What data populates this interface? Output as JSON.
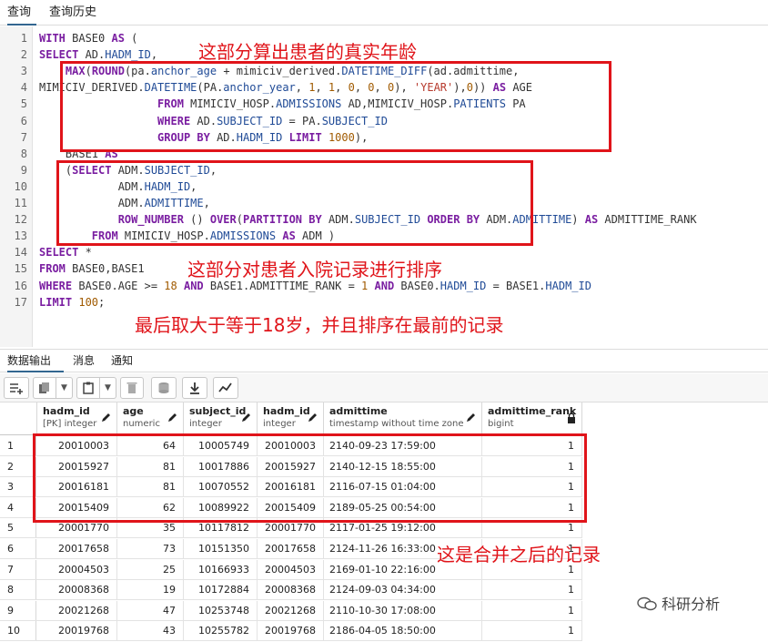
{
  "tabs": [
    "查询",
    "查询历史"
  ],
  "code_lines": [
    "WITH BASE0 AS (",
    "SELECT AD.HADM_ID,",
    "    MAX(ROUND(pa.anchor_age + mimiciv_derived.DATETIME_DIFF(ad.admittime,",
    "MIMICIV_DERIVED.DATETIME(PA.anchor_year, 1, 1, 0, 0, 0), 'YEAR'),0)) AS AGE",
    "                  FROM MIMICIV_HOSP.ADMISSIONS AD,MIMICIV_HOSP.PATIENTS PA",
    "                  WHERE AD.SUBJECT_ID = PA.SUBJECT_ID",
    "                  GROUP BY AD.HADM_ID LIMIT 1000),",
    "    BASE1 AS",
    "    (SELECT ADM.SUBJECT_ID,",
    "            ADM.HADM_ID,",
    "            ADM.ADMITTIME,",
    "            ROW_NUMBER () OVER(PARTITION BY ADM.SUBJECT_ID ORDER BY ADM.ADMITTIME) AS ADMITTIME_RANK",
    "        FROM MIMICIV_HOSP.ADMISSIONS AS ADM )",
    "SELECT *",
    "FROM BASE0,BASE1",
    "WHERE BASE0.AGE >= 18 AND BASE1.ADMITTIME_RANK = 1 AND BASE0.HADM_ID = BASE1.HADM_ID",
    "LIMIT 100;"
  ],
  "annotations": {
    "age": "这部分算出患者的真实年龄",
    "rank": "这部分对患者入院记录进行排序",
    "filter": "最后取大于等于18岁，并且排序在最前的记录",
    "merged": "这是合并之后的记录"
  },
  "output_tabs": [
    "数据输出",
    "消息",
    "通知"
  ],
  "toolbar_icons": [
    "add-row-icon",
    "copy-icon",
    "paste-icon",
    "delete-icon",
    "save-data-icon",
    "download-icon",
    "graph-icon"
  ],
  "columns": [
    {
      "name": "hadm_id",
      "type": "[PK] integer",
      "icon": "pencil-icon"
    },
    {
      "name": "age",
      "type": "numeric",
      "icon": "pencil-icon"
    },
    {
      "name": "subject_id",
      "type": "integer",
      "icon": "pencil-icon"
    },
    {
      "name": "hadm_id",
      "type": "integer",
      "icon": "pencil-icon"
    },
    {
      "name": "admittime",
      "type": "timestamp without time zone",
      "icon": "pencil-icon"
    },
    {
      "name": "admittime_rank",
      "type": "bigint",
      "icon": "lock-icon"
    }
  ],
  "rows": [
    [
      "1",
      "20010003",
      "64",
      "10005749",
      "20010003",
      "2140-09-23 17:59:00",
      "1"
    ],
    [
      "2",
      "20015927",
      "81",
      "10017886",
      "20015927",
      "2140-12-15 18:55:00",
      "1"
    ],
    [
      "3",
      "20016181",
      "81",
      "10070552",
      "20016181",
      "2116-07-15 01:04:00",
      "1"
    ],
    [
      "4",
      "20015409",
      "62",
      "10089922",
      "20015409",
      "2189-05-25 00:54:00",
      "1"
    ],
    [
      "5",
      "20001770",
      "35",
      "10117812",
      "20001770",
      "2117-01-25 19:12:00",
      "1"
    ],
    [
      "6",
      "20017658",
      "73",
      "10151350",
      "20017658",
      "2124-11-26 16:33:00",
      "1"
    ],
    [
      "7",
      "20004503",
      "25",
      "10166933",
      "20004503",
      "2169-01-10 22:16:00",
      "1"
    ],
    [
      "8",
      "20008368",
      "19",
      "10172884",
      "20008368",
      "2124-09-03 04:34:00",
      "1"
    ],
    [
      "9",
      "20021268",
      "47",
      "10253748",
      "20021268",
      "2110-10-30 17:08:00",
      "1"
    ],
    [
      "10",
      "20019768",
      "43",
      "10255782",
      "20019768",
      "2186-04-05 18:50:00",
      "1"
    ]
  ],
  "watermark": "科研分析",
  "colors": {
    "annotation_red": "#e0141a",
    "keyword": "#7a1ea1",
    "identifier": "#1f4a96"
  }
}
